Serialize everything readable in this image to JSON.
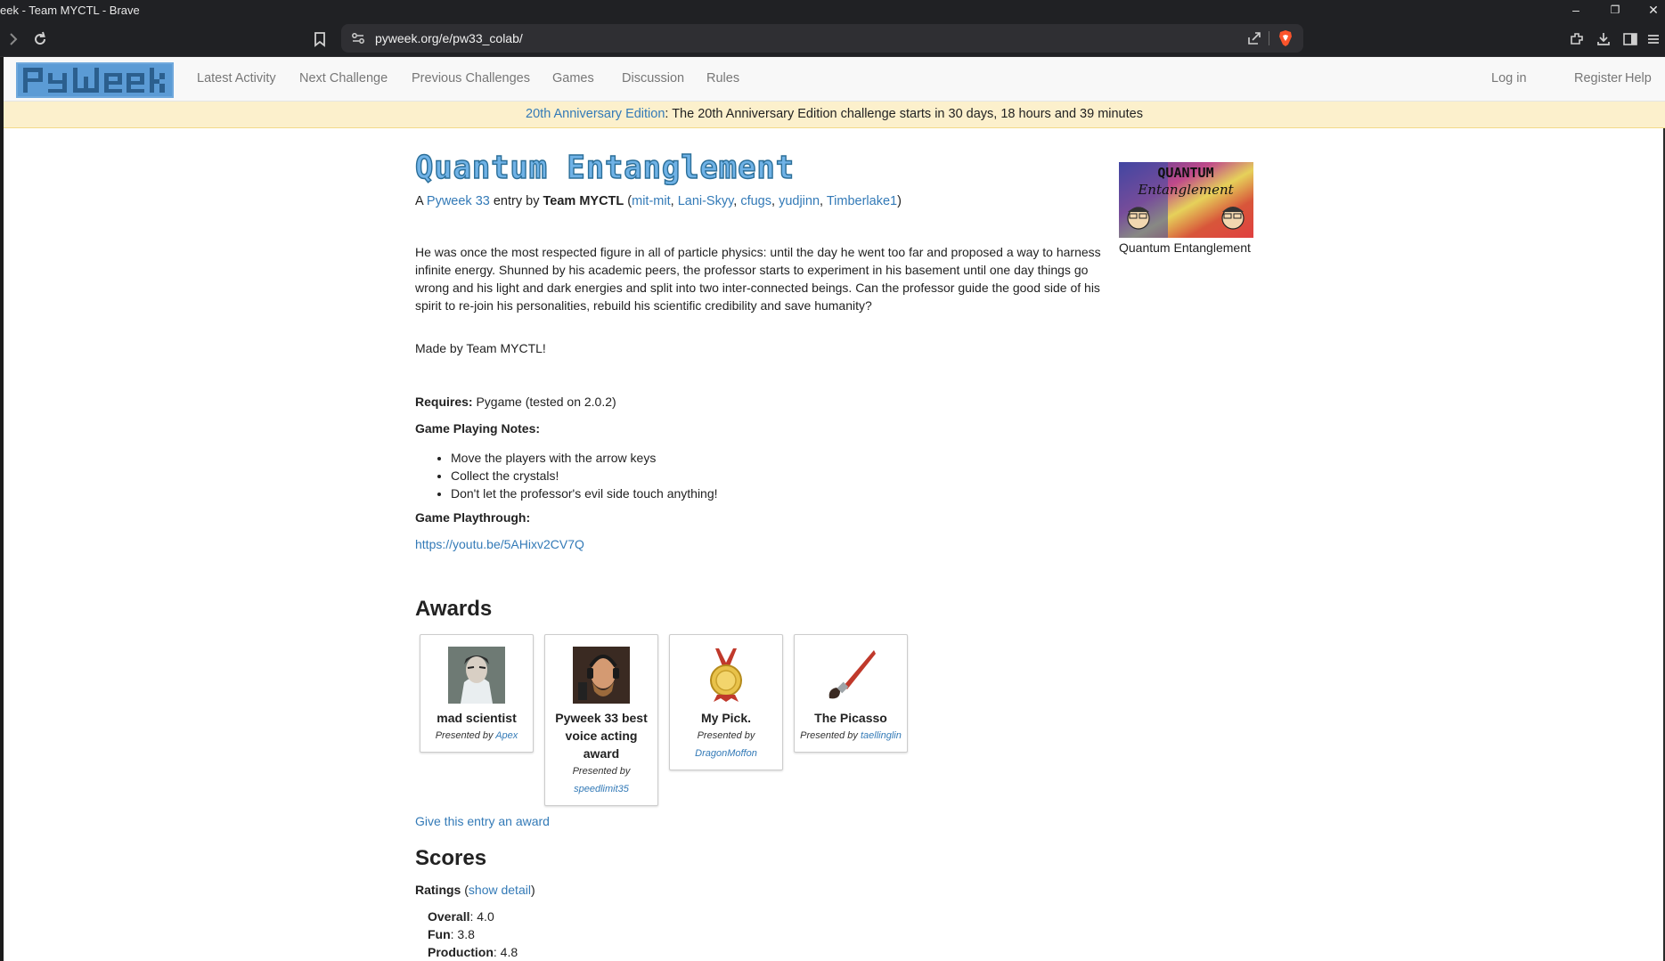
{
  "browser": {
    "window_title": "eek - Team MYCTL - Brave",
    "url": "pyweek.org/e/pw33_colab/"
  },
  "nav": {
    "logo_alt": "PyWeek",
    "links": [
      "Latest Activity",
      "Next Challenge",
      "Previous Challenges",
      "Games",
      "Discussion",
      "Rules"
    ],
    "right_links": [
      "Log in",
      "Register",
      "Help"
    ]
  },
  "announcement": {
    "link": "20th Anniversary Edition",
    "text": ": The 20th Anniversary Edition challenge starts in 30 days, 18 hours and 39 minutes"
  },
  "entry": {
    "title": "Quantum Entanglement",
    "by_prefix": "A ",
    "challenge": "Pyweek 33",
    "entry_by": " entry by ",
    "team": "Team MYCTL",
    "members": [
      "mit-mit",
      "Lani-Skyy",
      "cfugs",
      "yudjinn",
      "Timberlake1"
    ],
    "description": "He was once the most respected figure in all of particle physics: until the day he went too far and proposed a way to harness infinite energy. Shunned by his academic peers, the professor starts to experiment in his basement until one day things go wrong and his light and dark energies and split into two inter-connected beings. Can the professor guide the good side of his spirit to re-join his personalities, rebuild his scientific credibility and save humanity?",
    "made_by": "Made by Team MYCTL!",
    "requires_label": "Requires:",
    "requires_value": " Pygame (tested on 2.0.2)",
    "notes_label": "Game Playing Notes:",
    "notes": [
      "Move the players with the arrow keys",
      "Collect the crystals!",
      "Don't let the professor's evil side touch anything!"
    ],
    "playthrough_label": "Game Playthrough:",
    "playthrough_link": "https://youtu.be/5AHixv2CV7Q",
    "thumbnail_caption": "Quantum Entanglement",
    "thumbnail_text_1": "QUANTUM",
    "thumbnail_text_2": "Entanglement"
  },
  "awards": {
    "heading": "Awards",
    "presented_by": "Presented by",
    "items": [
      {
        "name": "mad scientist",
        "by": "Apex",
        "icon": "mad-scientist-award-icon"
      },
      {
        "name": "Pyweek 33 best voice acting award",
        "by": "speedlimit35",
        "icon": "voice-acting-award-icon"
      },
      {
        "name": "My Pick.",
        "by": "DragonMoffon",
        "icon": "medal-award-icon"
      },
      {
        "name": "The Picasso",
        "by": "taellinglin",
        "icon": "paintbrush-award-icon"
      }
    ],
    "give_link": "Give this entry an award"
  },
  "scores": {
    "heading": "Scores",
    "ratings_label": "Ratings",
    "show_detail": "show detail",
    "items": [
      {
        "label": "Overall",
        "value": ": 4.0"
      },
      {
        "label": "Fun",
        "value": ": 3.8"
      },
      {
        "label": "Production",
        "value": ": 4.8"
      }
    ]
  }
}
